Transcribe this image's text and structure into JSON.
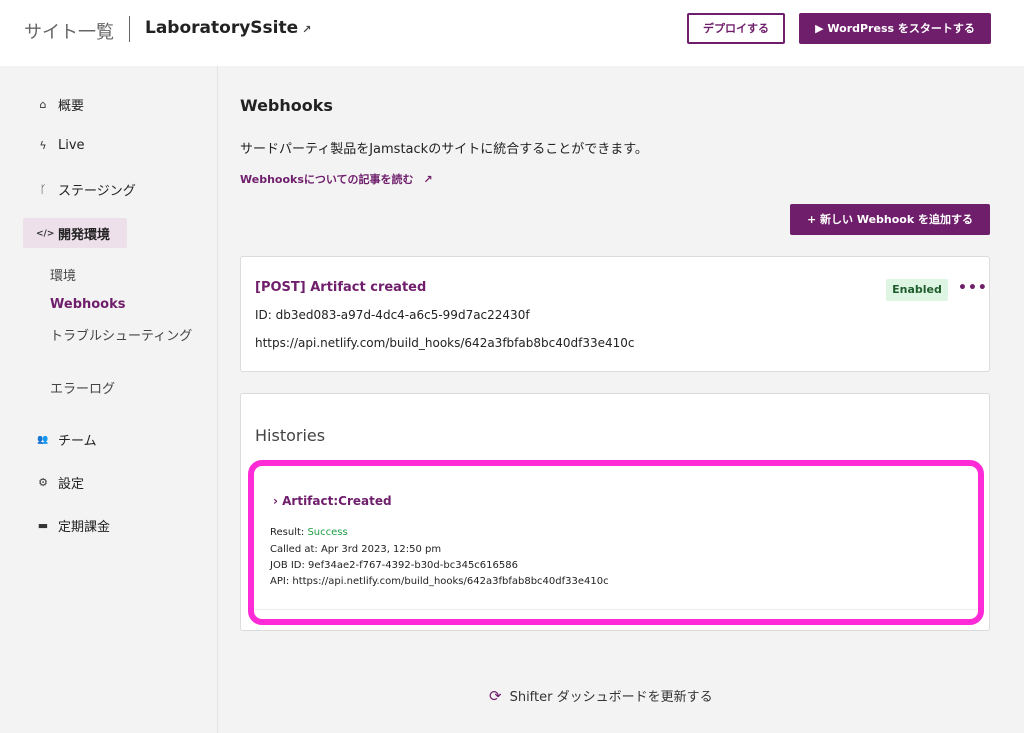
{
  "header": {
    "breadcrumb": "サイト一覧",
    "site_name": "LaboratorySsite",
    "edit_icon": "↗",
    "deploy_label": "デプロイする",
    "start_label": "▶ WordPress をスタートする"
  },
  "sidebar": {
    "items": [
      {
        "icon": "home-icon",
        "glyph": "⌂",
        "label": "概要"
      },
      {
        "icon": "bolt-icon",
        "glyph": "ϟ",
        "label": "Live"
      },
      {
        "icon": "branch-icon",
        "glyph": "ᚴ",
        "label": "ステージング"
      },
      {
        "icon": "code-icon",
        "glyph": "</>",
        "label": "開発環境"
      },
      {
        "icon": "team-icon",
        "glyph": "👥",
        "label": "チーム"
      },
      {
        "icon": "gear-icon",
        "glyph": "⚙",
        "label": "設定"
      },
      {
        "icon": "card-icon",
        "glyph": "▬",
        "label": "定期課金"
      }
    ],
    "subitems": [
      "環境",
      "Webhooks",
      "トラブルシューティング",
      "エラーログ"
    ]
  },
  "main": {
    "title": "Webhooks",
    "description": "サードパーティ製品をJamstackのサイトに統合することができます。",
    "doc_link": "Webhooksについての記事を読む",
    "doc_link_icon": "↗",
    "add_button": "+ 新しい Webhook を追加する",
    "webhook": {
      "title": "[POST] Artifact created",
      "id_line": "ID: db3ed083-a97d-4dc4-a6c5-99d7ac22430f",
      "url": "https://api.netlify.com/build_hooks/642a3fbfab8bc40df33e410c",
      "status": "Enabled",
      "more": "•••"
    },
    "histories": {
      "title": "Histories",
      "entry": {
        "title": "› Artifact:Created",
        "result_label": "Result: ",
        "result_value": "Success",
        "called_at": "Called at: Apr 3rd 2023, 12:50 pm",
        "job_id": "JOB ID: 9ef34ae2-f767-4392-b30d-bc345c616586",
        "api": "API: https://api.netlify.com/build_hooks/642a3fbfab8bc40df33e410c"
      }
    },
    "refresh": {
      "icon": "refresh-icon",
      "glyph": "⟳",
      "label": "Shifter ダッシュボードを更新する"
    }
  },
  "colors": {
    "brand": "#6f1e6b",
    "highlight": "#ff2bd6",
    "success": "#1e9e44",
    "badge_bg": "#dff5e3"
  }
}
